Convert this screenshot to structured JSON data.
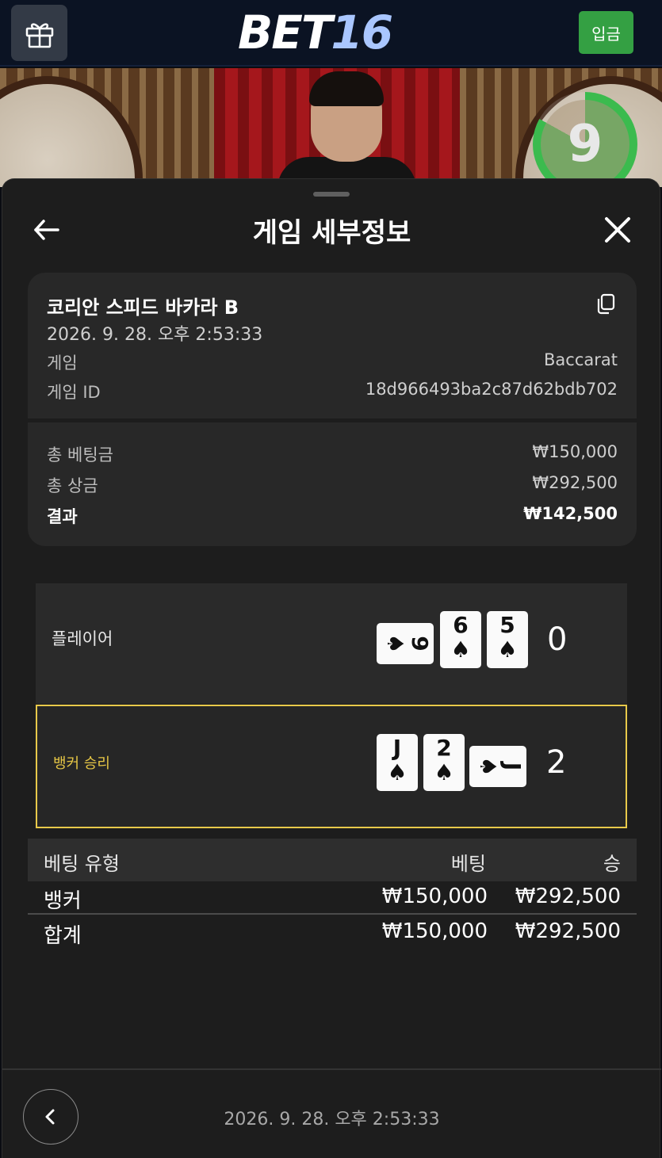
{
  "header": {
    "logo_part1": "BET",
    "logo_part2": "16",
    "deposit_label": "입금"
  },
  "stream": {
    "timer_value": "9",
    "timer_progress": 0.83
  },
  "sheet": {
    "title": "게임 세부정보"
  },
  "summary": {
    "game_name": "코리안 스피드 바카라 B",
    "datetime": "2026. 9. 28. 오후 2:53:33",
    "game_label": "게임",
    "game_value": "Baccarat",
    "game_id_label": "게임 ID",
    "game_id_value": "18d966493ba2c87d62bdb702",
    "total_bet_label": "총 베팅금",
    "total_bet_value": "₩150,000",
    "total_prize_label": "총 상금",
    "total_prize_value": "₩292,500",
    "result_label": "결과",
    "result_value": "₩142,500"
  },
  "hands": {
    "player": {
      "label": "플레이어",
      "cards": [
        {
          "rank": "9",
          "suit": "♠",
          "sideways": true
        },
        {
          "rank": "6",
          "suit": "♠",
          "sideways": false
        },
        {
          "rank": "5",
          "suit": "♠",
          "sideways": false
        }
      ],
      "score": "0"
    },
    "banker": {
      "label": "뱅커 승리",
      "cards": [
        {
          "rank": "J",
          "suit": "♠",
          "sideways": false
        },
        {
          "rank": "2",
          "suit": "♠",
          "sideways": false
        },
        {
          "rank": "J",
          "suit": "♠",
          "sideways": true
        }
      ],
      "score": "2",
      "highlight_color": "#e8c94a"
    }
  },
  "bets_table": {
    "headers": [
      "베팅 유형",
      "베팅",
      "승"
    ],
    "rows": [
      [
        "뱅커",
        "₩150,000",
        "₩292,500"
      ]
    ],
    "total": [
      "합계",
      "₩150,000",
      "₩292,500"
    ]
  },
  "footer": {
    "datetime": "2026. 9. 28. 오후 2:53:33"
  },
  "colors": {
    "deposit": "#34a043",
    "timer": "#3bbb4e",
    "highlight": "#e8c94a"
  }
}
